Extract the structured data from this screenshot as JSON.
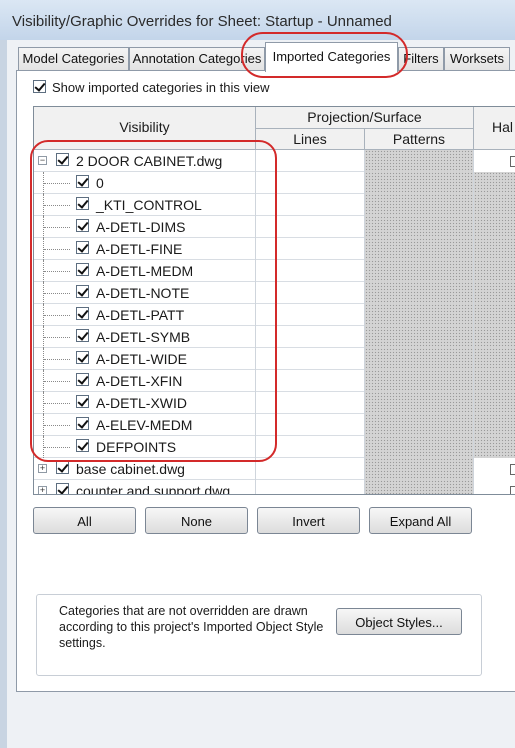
{
  "window": {
    "title": "Visibility/Graphic Overrides for Sheet: Startup - Unnamed"
  },
  "tabs": [
    {
      "label": "Model Categories",
      "active": false
    },
    {
      "label": "Annotation Categories",
      "active": false
    },
    {
      "label": "Imported Categories",
      "active": true
    },
    {
      "label": "Filters",
      "active": false
    },
    {
      "label": "Worksets",
      "active": false
    }
  ],
  "show_imported": {
    "label": "Show imported categories in this view",
    "checked": true
  },
  "grid": {
    "headers": {
      "visibility": "Visibility",
      "projection_surface": "Projection/Surface",
      "lines": "Lines",
      "patterns": "Patterns",
      "halftone": "Hal"
    },
    "rows": [
      {
        "name": "2 DOOR CABINET.dwg",
        "level": 0,
        "expander": "−",
        "checked": true
      },
      {
        "name": "0",
        "level": 1,
        "checked": true
      },
      {
        "name": "_KTI_CONTROL",
        "level": 1,
        "checked": true
      },
      {
        "name": "A-DETL-DIMS",
        "level": 1,
        "checked": true
      },
      {
        "name": "A-DETL-FINE",
        "level": 1,
        "checked": true
      },
      {
        "name": "A-DETL-MEDM",
        "level": 1,
        "checked": true
      },
      {
        "name": "A-DETL-NOTE",
        "level": 1,
        "checked": true
      },
      {
        "name": "A-DETL-PATT",
        "level": 1,
        "checked": true
      },
      {
        "name": "A-DETL-SYMB",
        "level": 1,
        "checked": true
      },
      {
        "name": "A-DETL-WIDE",
        "level": 1,
        "checked": true
      },
      {
        "name": "A-DETL-XFIN",
        "level": 1,
        "checked": true
      },
      {
        "name": "A-DETL-XWID",
        "level": 1,
        "checked": true
      },
      {
        "name": "A-ELEV-MEDM",
        "level": 1,
        "checked": true
      },
      {
        "name": "DEFPOINTS",
        "level": 1,
        "checked": true
      },
      {
        "name": "base cabinet.dwg",
        "level": 0,
        "expander": "+",
        "checked": true
      },
      {
        "name": "counter and support.dwg",
        "level": 0,
        "expander": "+",
        "checked": true
      }
    ]
  },
  "buttons": {
    "all": "All",
    "none": "None",
    "invert": "Invert",
    "expand_all": "Expand All"
  },
  "note": {
    "text": "Categories that are not overridden are drawn according to this project's Imported Object Style settings.",
    "button": "Object Styles..."
  },
  "colors": {
    "annotation": "#d32a2a",
    "background": "#eef1f5"
  }
}
